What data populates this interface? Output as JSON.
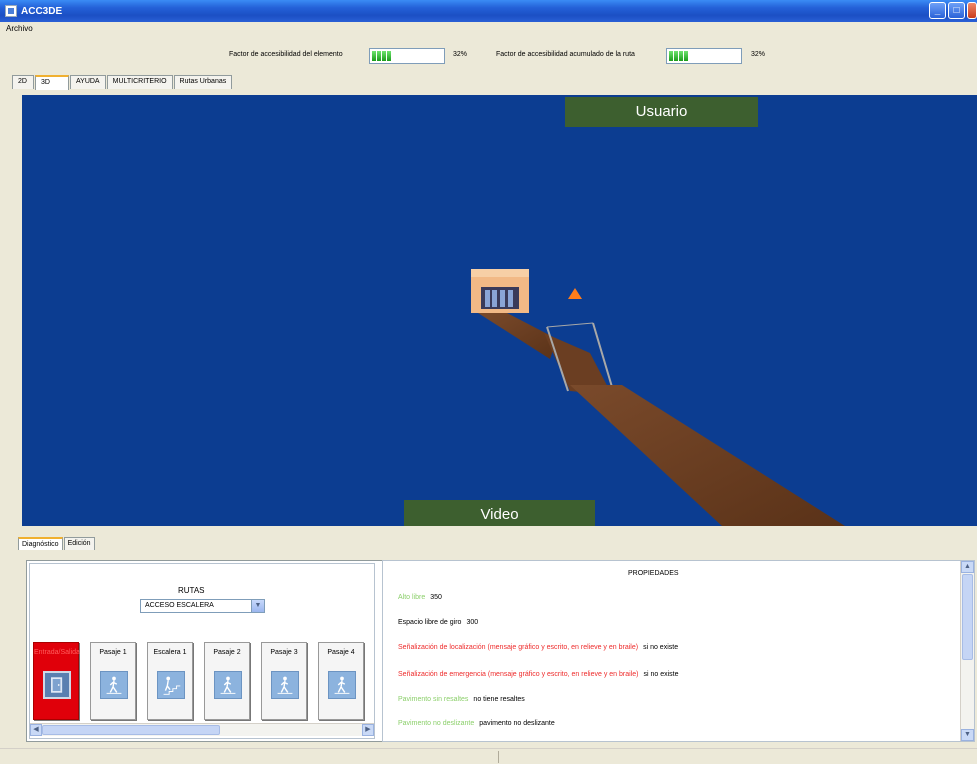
{
  "window": {
    "title": "ACC3DE"
  },
  "menu": {
    "items": [
      "Archivo"
    ]
  },
  "factors": {
    "element_label": "Factor de accesibilidad del elemento",
    "element_pct": "32%",
    "element_value": 0.32,
    "route_label": "Factor de accesibilidad acumulado de la ruta",
    "route_pct": "32%",
    "route_value": 0.32
  },
  "tabs": [
    "2D",
    "3D",
    "AYUDA",
    "MULTICRITERIO",
    "Rutas Urbanas"
  ],
  "active_tab": "3D",
  "viewport": {
    "usuario_label": "Usuario",
    "video_label": "Video"
  },
  "bottom_tabs": [
    "Diagnóstico",
    "Edición"
  ],
  "rutas": {
    "title": "RUTAS",
    "selected": "ACCESO ESCALERA",
    "cards": [
      {
        "label": "Entrada/Salida",
        "icon": "door-icon",
        "selected": true
      },
      {
        "label": "Pasaje 1",
        "icon": "walking-person-icon",
        "selected": false
      },
      {
        "label": "Escalera 1",
        "icon": "stairs-icon",
        "selected": false
      },
      {
        "label": "Pasaje 2",
        "icon": "walking-person-icon",
        "selected": false
      },
      {
        "label": "Pasaje 3",
        "icon": "walking-person-icon",
        "selected": false
      },
      {
        "label": "Pasaje 4",
        "icon": "walking-person-icon",
        "selected": false
      }
    ]
  },
  "properties": {
    "title": "PROPIEDADES",
    "items": [
      {
        "key": "Alto libre",
        "value": "350",
        "color": "#8bcf6a"
      },
      {
        "key": "Espacio libre de giro",
        "value": "300",
        "color": "#000000"
      },
      {
        "key": "Señalización de localización (mensaje gráfico y escrito, en relieve y en braile)",
        "value": "si no existe",
        "color": "#ee2b2b"
      },
      {
        "key": "Señalización de emergencia (mensaje gráfico y escrito, en relieve y en braile)",
        "value": "si no existe",
        "color": "#ee2b2b"
      },
      {
        "key": "Pavimento sin resaltes",
        "value": "no tiene resaltes",
        "color": "#8bcf6a"
      },
      {
        "key": "Pavimento no deslizante",
        "value": "pavimento no deslizante",
        "color": "#8bcf6a"
      }
    ]
  }
}
